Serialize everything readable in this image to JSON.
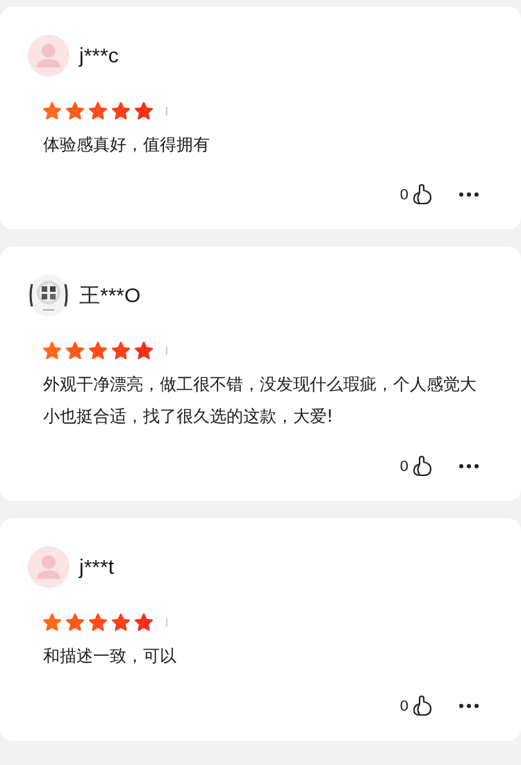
{
  "reviews": [
    {
      "user": "j***c",
      "avatar": {
        "kind": "default"
      },
      "stars": 5,
      "text": "体验感真好，值得拥有",
      "likes": "0"
    },
    {
      "user": "王***O",
      "stars": 5,
      "text": "外观干净漂亮，做工很不错，没发现什么瑕疵，个人感觉大小也挺合适，找了很久选的这款，大爱!",
      "likes": "0"
    },
    {
      "user": "j***t",
      "avatar": {
        "kind": "default"
      },
      "stars": 5,
      "text": "和描述一致，可以",
      "likes": "0"
    }
  ]
}
